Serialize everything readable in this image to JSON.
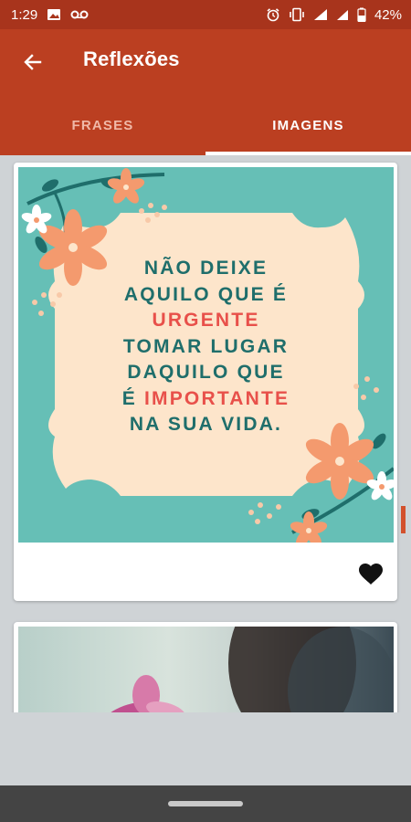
{
  "status_bar": {
    "time": "1:29",
    "battery_percent": "42%",
    "left_icons": [
      "image-icon",
      "voicemail-icon"
    ],
    "right_icons": [
      "alarm-icon",
      "vibrate-icon",
      "wifi-icon",
      "signal-icon",
      "battery-icon"
    ]
  },
  "app_bar": {
    "title": "Reflexões",
    "back_icon": "arrow-back-icon",
    "color": "#bb3f21"
  },
  "tabs": [
    {
      "label": "FRASES",
      "selected": false
    },
    {
      "label": "IMAGENS",
      "selected": true
    }
  ],
  "cards": [
    {
      "quote": {
        "line1": "NÃO DEIXE",
        "line2": "AQUILO QUE É",
        "line3": "URGENTE",
        "line4": "TOMAR LUGAR",
        "line5": "DAQUILO QUE",
        "line6_prefix": "É ",
        "line6_highlight": "IMPORTANTE",
        "line7": "NA SUA VIDA."
      },
      "colors": {
        "background": "#66bfb6",
        "frame": "#fde5cb",
        "text": "#1f6e6b",
        "highlight": "#e8504a"
      },
      "like_icon": "heart-icon"
    },
    {
      "image": "woman-and-pink-flower-photo"
    }
  ]
}
